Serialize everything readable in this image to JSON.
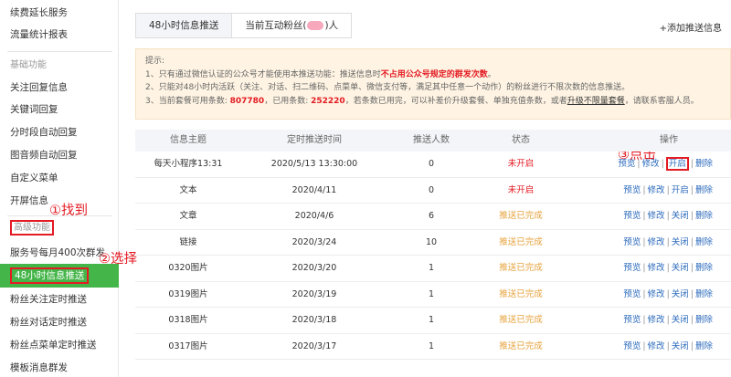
{
  "sidebar": {
    "items": [
      {
        "label": "续费延长服务"
      },
      {
        "label": "流量统计报表"
      },
      {
        "label": "基础功能"
      },
      {
        "label": "关注回复信息"
      },
      {
        "label": "关键词回复"
      },
      {
        "label": "分时段自动回复"
      },
      {
        "label": "图音频自动回复"
      },
      {
        "label": "自定义菜单"
      },
      {
        "label": "开屏信息"
      },
      {
        "label": "高级功能"
      },
      {
        "label": "服务号每月400次群发"
      },
      {
        "label": "48小时信息推送"
      },
      {
        "label": "粉丝关注定时推送"
      },
      {
        "label": "粉丝对话定时推送"
      },
      {
        "label": "粉丝点菜单定时推送"
      },
      {
        "label": "模板消息群发"
      }
    ]
  },
  "annotations": {
    "find": "①找到",
    "select": "②选择",
    "click": "③点击"
  },
  "tabs": {
    "tab1": "48小时信息推送",
    "tab2_prefix": "当前互动粉丝(",
    "tab2_suffix": ")人"
  },
  "add_link": "+添加推送信息",
  "notice": {
    "title": "提示:",
    "line1_a": "1、只有通过微信认证的公众号才能使用本推送功能：推送信息时",
    "line1_b": "不占用公众号规定的群发次数",
    "line1_c": "。",
    "line2": "2、只能对48小时内活跃（关注、对话、扫二维码、点菜单、微信支付等，满足其中任意一个动作）的粉丝进行不限次数的信息推送。",
    "line3_a": "3、当前套餐可用条数: ",
    "line3_total": "807780",
    "line3_b": "，已用条数: ",
    "line3_used": "252220",
    "line3_c": "，若条数已用完，可以补差价升级套餐、单独充值条数，或者",
    "line3_link": "升级不限量套餐",
    "line3_d": "，请联系客服人员。"
  },
  "table": {
    "headers": {
      "topic": "信息主题",
      "time": "定时推送时间",
      "count": "推送人数",
      "status": "状态",
      "ops": "操作"
    },
    "ops_labels": {
      "preview": "预览",
      "edit": "修改",
      "open": "开启",
      "close": "关闭",
      "delete": "删除",
      "sep": "|"
    },
    "rows": [
      {
        "topic": "每天小程序13:31",
        "time": "2020/5/13 13:30:00",
        "count": "0",
        "status": "未开启",
        "toggle": "开启"
      },
      {
        "topic": "文本",
        "time": "2020/4/11",
        "count": "0",
        "status": "未开启",
        "toggle": "开启"
      },
      {
        "topic": "文章",
        "time": "2020/4/6",
        "count": "6",
        "status": "推送已完成",
        "toggle": "关闭"
      },
      {
        "topic": "链接",
        "time": "2020/3/24",
        "count": "10",
        "status": "推送已完成",
        "toggle": "关闭"
      },
      {
        "topic": "0320图片",
        "time": "2020/3/20",
        "count": "1",
        "status": "推送已完成",
        "toggle": "关闭"
      },
      {
        "topic": "0319图片",
        "time": "2020/3/19",
        "count": "1",
        "status": "推送已完成",
        "toggle": "关闭"
      },
      {
        "topic": "0318图片",
        "time": "2020/3/18",
        "count": "1",
        "status": "推送已完成",
        "toggle": "关闭"
      },
      {
        "topic": "0317图片",
        "time": "2020/3/17",
        "count": "1",
        "status": "推送已完成",
        "toggle": "关闭"
      }
    ]
  },
  "colors": {
    "accent_green": "#44b549",
    "annotation_red": "#e31b23",
    "status_orange": "#e6a23c",
    "link_blue": "#2d6bbd"
  }
}
